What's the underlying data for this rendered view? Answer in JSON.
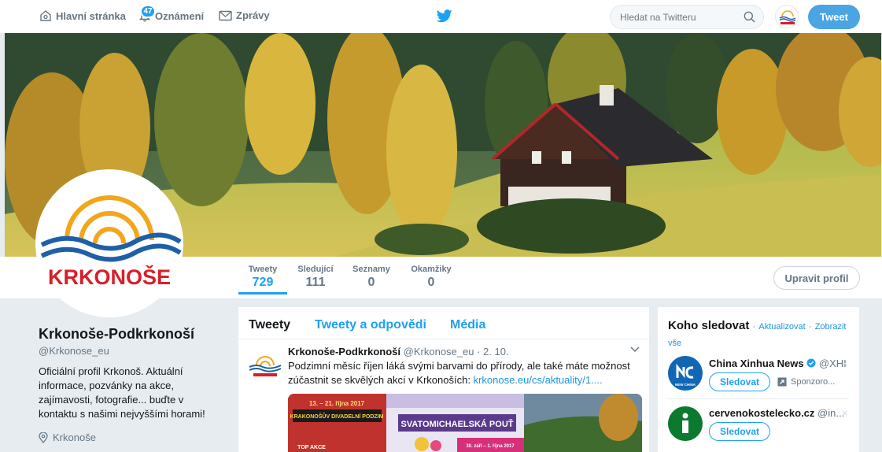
{
  "topnav": {
    "home_label": "Hlavní stránka",
    "notifications_label": "Oznámení",
    "notifications_badge": "47",
    "messages_label": "Zprávy",
    "search_placeholder": "Hledat na Twitteru",
    "tweet_button": "Tweet"
  },
  "brand": {
    "logo_text": "KRKONOŠE",
    "accent": "#1da1f2",
    "logo_red": "#d5202a",
    "logo_blue": "#1e5fa8",
    "logo_orange": "#f2a61c"
  },
  "profile_nav": {
    "stats": [
      {
        "label": "Tweety",
        "value": "729"
      },
      {
        "label": "Sledující",
        "value": "111"
      },
      {
        "label": "Seznamy",
        "value": "0"
      },
      {
        "label": "Okamžiky",
        "value": "0"
      }
    ],
    "edit_button": "Upravit profil"
  },
  "profile": {
    "name": "Krkonoše-Podkrkonoší",
    "handle": "@Krkonose_eu",
    "bio": "Oficiální profil Krkonoš. Aktuální informace, pozvánky na akce, zajímavosti, fotografie... buďte v kontaktu s našimi nejvyššími horami!",
    "location": "Krkonoše"
  },
  "timeline": {
    "tabs": [
      "Tweety",
      "Tweety a odpovědi",
      "Média"
    ],
    "tweet": {
      "author": "Krkonoše-Podkrkonoší",
      "handle": "@Krkonose_eu",
      "date": "· 2. 10.",
      "text": "Podzimní měsíc říjen láká svými barvami do přírody, ale také máte možnost zúčastnit se skvělých akcí v Krkonoších: ",
      "link": "krkonose.eu/cs/aktuality/1....",
      "media": {
        "poster1_dates": "13. – 21. října 2017",
        "poster1_title": "KRAKONOŠŮV DIVADELNÍ PODZIM",
        "poster2_title": "SVATOMICHAELSKÁ POUŤ",
        "poster3_title": "TOP AKCE",
        "poster2_dates": "30. září – 1. října 2017"
      }
    }
  },
  "who_to_follow": {
    "title": "Koho sledovat",
    "separator": "·",
    "refresh": "Aktualizovat",
    "view_all": "Zobrazit vše",
    "accounts": [
      {
        "name": "China Xinhua News",
        "handle": "@XHI",
        "button": "Sledovat",
        "sponsored": "Sponzoro...",
        "avatar_text": "NEW CHINA"
      },
      {
        "name": "cervenokostelecko.cz",
        "handle": "@in...",
        "button": "Sledovat"
      }
    ],
    "dismiss": "×"
  }
}
